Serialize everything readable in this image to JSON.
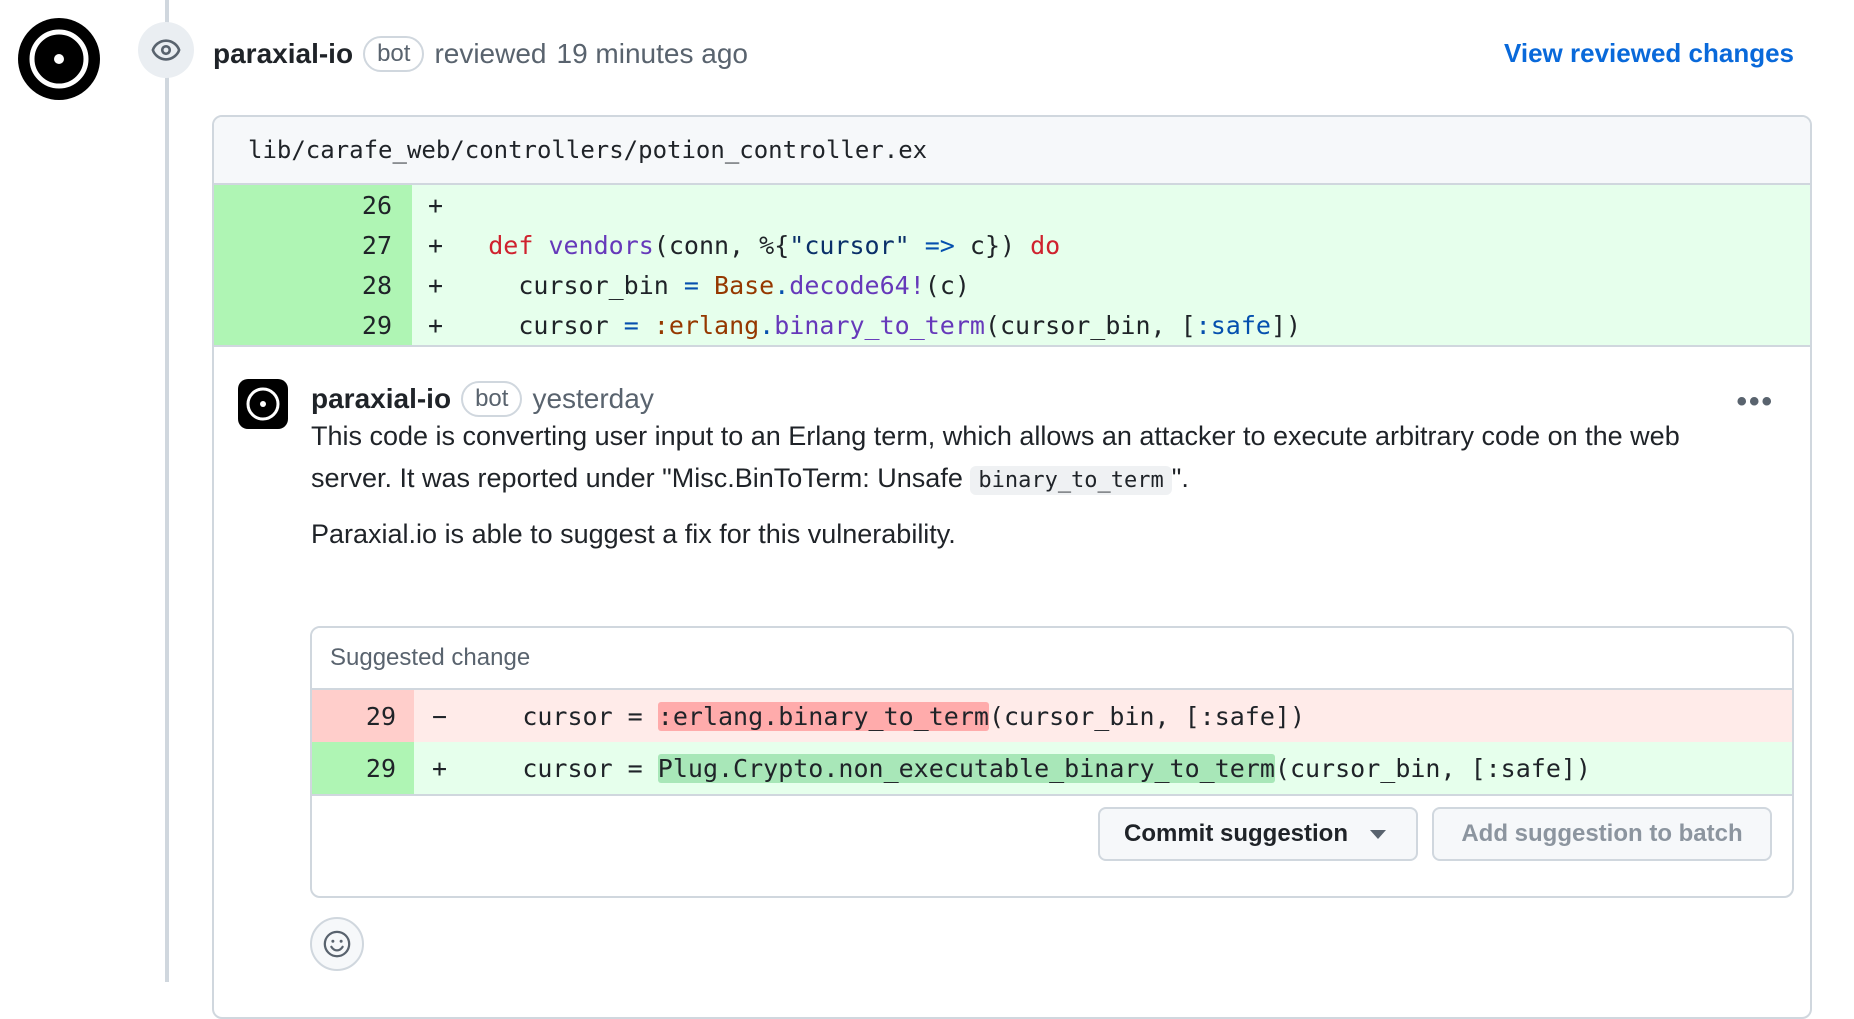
{
  "review": {
    "author": "paraxial-io",
    "badge": "bot",
    "action": "reviewed",
    "time": "19 minutes ago",
    "view_link": "View reviewed changes",
    "avatar_icon": "paraxial-logo-icon",
    "event_icon": "eye-icon"
  },
  "file": {
    "path": "lib/carafe_web/controllers/potion_controller.ex",
    "lines": [
      {
        "num": "26",
        "sign": "+",
        "code": ""
      },
      {
        "num": "27",
        "sign": "+",
        "code": "def vendors(conn, %{\"cursor\" => c}) do"
      },
      {
        "num": "28",
        "sign": "+",
        "code": "cursor_bin = Base.decode64!(c)"
      },
      {
        "num": "29",
        "sign": "+",
        "code": "cursor = :erlang.binary_to_term(cursor_bin, [:safe])"
      }
    ]
  },
  "comment": {
    "author": "paraxial-io",
    "badge": "bot",
    "time": "yesterday",
    "more_icon": "kebab-menu-icon",
    "paragraph1_a": "This code is converting user input to an Erlang term, which allows an attacker to execute arbitrary code on the web server. It was reported under \"Misc.BinToTerm: Unsafe ",
    "paragraph1_code": "binary_to_term",
    "paragraph1_b": "\".",
    "paragraph2": "Paraxial.io is able to suggest a fix for this vulnerability."
  },
  "suggestion": {
    "title": "Suggested change",
    "removed": {
      "num": "29",
      "sign": "−",
      "prefix": "cursor = ",
      "highlight": ":erlang.binary_to_term",
      "suffix": "(cursor_bin, [:safe])"
    },
    "added": {
      "num": "29",
      "sign": "+",
      "prefix": "cursor = ",
      "highlight": "Plug.Crypto.non_executable_binary_to_term",
      "suffix": "(cursor_bin, [:safe])"
    },
    "commit_label": "Commit suggestion",
    "batch_label": "Add suggestion to batch"
  },
  "reaction": {
    "icon": "smiley-icon"
  },
  "colors": {
    "link": "#0969da",
    "add_line_bg": "#e6ffec",
    "add_num_bg": "#aff5b4",
    "del_line_bg": "#ffebe9",
    "del_num_bg": "#ffcecb"
  }
}
